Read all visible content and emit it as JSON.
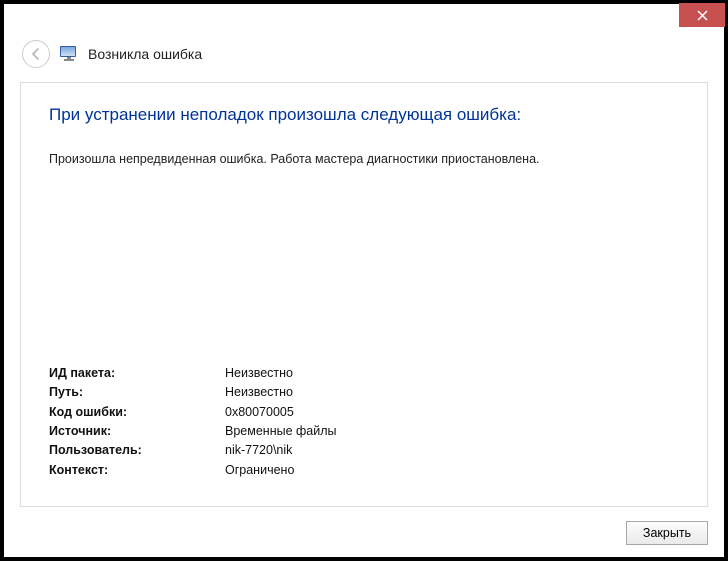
{
  "titlebar": {
    "close_label": "Close"
  },
  "header": {
    "window_title": "Возникла ошибка"
  },
  "content": {
    "heading": "При устранении неполадок произошла следующая ошибка:",
    "message": "Произошла непредвиденная ошибка. Работа мастера диагностики приостановлена."
  },
  "details": {
    "rows": [
      {
        "label": "ИД пакета:",
        "value": "Неизвестно"
      },
      {
        "label": "Путь:",
        "value": "Неизвестно"
      },
      {
        "label": "Код ошибки:",
        "value": "0x80070005"
      },
      {
        "label": "Источник:",
        "value": "Временные файлы"
      },
      {
        "label": "Пользователь:",
        "value": "nik-7720\\nik"
      },
      {
        "label": "Контекст:",
        "value": "Ограничено"
      }
    ]
  },
  "footer": {
    "close_button": "Закрыть"
  }
}
